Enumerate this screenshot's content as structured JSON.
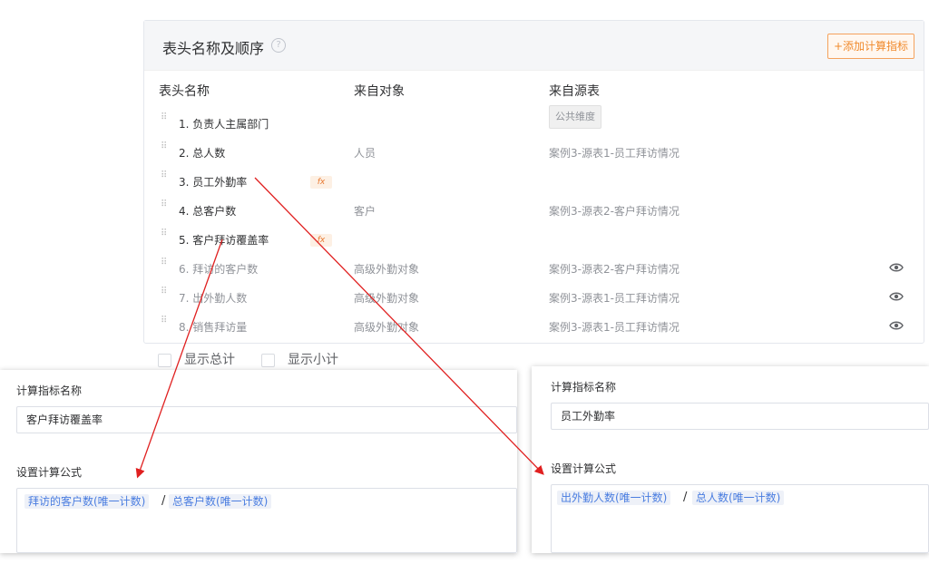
{
  "panel": {
    "title": "表头名称及顺序",
    "help_glyph": "?",
    "add_button": "+添加计算指标",
    "columns": [
      "表头名称",
      "来自对象",
      "来自源表"
    ],
    "public_tag": "公共维度",
    "rows": [
      {
        "name": "1. 负责人主属部门",
        "object": "",
        "source": "",
        "fx": false,
        "eye": false,
        "dim": false
      },
      {
        "name": "2. 总人数",
        "object": "人员",
        "source": "案例3-源表1-员工拜访情况",
        "fx": false,
        "eye": false,
        "dim": false
      },
      {
        "name": "3. 员工外勤率",
        "object": "",
        "source": "",
        "fx": true,
        "eye": false,
        "dim": false
      },
      {
        "name": "4. 总客户数",
        "object": "客户",
        "source": "案例3-源表2-客户拜访情况",
        "fx": false,
        "eye": false,
        "dim": false
      },
      {
        "name": "5. 客户拜访覆盖率",
        "object": "",
        "source": "",
        "fx": true,
        "eye": false,
        "dim": false
      },
      {
        "name": "6. 拜访的客户数",
        "object": "高级外勤对象",
        "source": "案例3-源表2-客户拜访情况",
        "fx": false,
        "eye": true,
        "dim": true
      },
      {
        "name": "7. 出外勤人数",
        "object": "高级外勤对象",
        "source": "案例3-源表1-员工拜访情况",
        "fx": false,
        "eye": true,
        "dim": true
      },
      {
        "name": "8. 销售拜访量",
        "object": "高级外勤对象",
        "source": "案例3-源表1-员工拜访情况",
        "fx": false,
        "eye": true,
        "dim": true
      }
    ],
    "fx_label": "fx"
  },
  "options": {
    "show_total": "显示总计",
    "show_subtotal": "显示小计"
  },
  "dialog_left": {
    "name_label": "计算指标名称",
    "name_value": "客户拜访覆盖率",
    "formula_label": "设置计算公式",
    "formula": {
      "left": "拜访的客户数(唯一计数)",
      "op": "/",
      "right": "总客户数(唯一计数)"
    }
  },
  "dialog_right": {
    "name_label": "计算指标名称",
    "name_value": "员工外勤率",
    "formula_label": "设置计算公式",
    "formula": {
      "left": "出外勤人数(唯一计数)",
      "op": "/",
      "right": "总人数(唯一计数)"
    }
  },
  "colors": {
    "accent_orange": "#f08a2c",
    "token_blue": "#4a7de0",
    "arrow_red": "#e02020"
  }
}
